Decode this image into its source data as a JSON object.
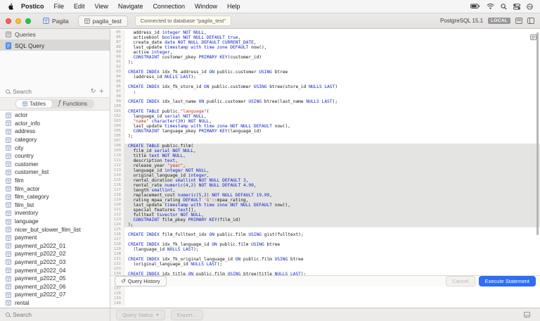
{
  "colors": {
    "accent": "#2e6ef2",
    "keyword": "#0d1fc4",
    "string": "#c52e1b",
    "number": "#0d1fc4"
  },
  "icons": {
    "refresh": "↻",
    "add": "+",
    "functions_glyph": "ƒ",
    "history": "↺"
  },
  "menu_bar": {
    "items": [
      "Postico",
      "File",
      "Edit",
      "View",
      "Navigate",
      "Connection",
      "Window",
      "Help"
    ],
    "status_icons": [
      "battery-icon",
      "wifi-icon",
      "search-icon",
      "control-center-icon",
      "siri-icon"
    ]
  },
  "title_bar": {
    "nav_label": "Pagila",
    "tab_label": "pagila_test",
    "status_message": "Connected to database \"pagila_test\"",
    "server_version": "PostgreSQL 15.1",
    "badge": "LOCAL"
  },
  "sidebar": {
    "queries_header": "Queries",
    "sql_query_label": "SQL Query",
    "search_placeholder": "Search",
    "tabs": [
      {
        "label": "Tables",
        "active": true
      },
      {
        "label": "Functions",
        "active": false
      }
    ],
    "tables": [
      "actor",
      "actor_info",
      "address",
      "category",
      "city",
      "country",
      "customer",
      "customer_list",
      "film",
      "film_actor",
      "film_category",
      "film_list",
      "inventory",
      "language",
      "nicer_but_slower_film_list",
      "payment",
      "payment_p2022_01",
      "payment_p2022_02",
      "payment_p2022_03",
      "payment_p2022_04",
      "payment_p2022_05",
      "payment_p2022_06",
      "payment_p2022_07",
      "rental"
    ],
    "bottom_search_placeholder": "Search"
  },
  "editor": {
    "selection": {
      "start": 108,
      "end": 124
    },
    "query_history_label": "Query History",
    "cancel_label": "Cancel",
    "execute_label": "Execute Statement",
    "lines": [
      {
        "n": 85,
        "s": [
          [
            "p",
            "  address_id "
          ],
          [
            "k",
            "integer"
          ],
          [
            "p",
            " "
          ],
          [
            "k",
            "NOT NULL"
          ],
          [
            "p",
            ","
          ]
        ]
      },
      {
        "n": 86,
        "s": [
          [
            "p",
            "  activebool "
          ],
          [
            "k",
            "boolean"
          ],
          [
            "p",
            " "
          ],
          [
            "k",
            "NOT NULL"
          ],
          [
            "p",
            " "
          ],
          [
            "k",
            "DEFAULT"
          ],
          [
            "p",
            " "
          ],
          [
            "k",
            "true"
          ],
          [
            "p",
            ","
          ]
        ]
      },
      {
        "n": 87,
        "s": [
          [
            "p",
            "  create_date "
          ],
          [
            "k",
            "date"
          ],
          [
            "p",
            " "
          ],
          [
            "k",
            "NOT NULL"
          ],
          [
            "p",
            " "
          ],
          [
            "k",
            "DEFAULT"
          ],
          [
            "p",
            " "
          ],
          [
            "k",
            "CURRENT_DATE"
          ],
          [
            "p",
            ","
          ]
        ]
      },
      {
        "n": 88,
        "s": [
          [
            "p",
            "  last_update "
          ],
          [
            "k",
            "timestamp with time zone"
          ],
          [
            "p",
            " "
          ],
          [
            "k",
            "DEFAULT"
          ],
          [
            "p",
            " now(),"
          ]
        ]
      },
      {
        "n": 89,
        "s": [
          [
            "p",
            "  active "
          ],
          [
            "k",
            "integer"
          ],
          [
            "p",
            ","
          ]
        ]
      },
      {
        "n": 90,
        "s": [
          [
            "p",
            "  "
          ],
          [
            "k",
            "CONSTRAINT"
          ],
          [
            "p",
            " customer_pkey "
          ],
          [
            "k",
            "PRIMARY KEY"
          ],
          [
            "p",
            "(customer_id)"
          ]
        ]
      },
      {
        "n": 91,
        "s": [
          [
            "p",
            ");"
          ]
        ]
      },
      {
        "n": 92,
        "s": []
      },
      {
        "n": 93,
        "s": [
          [
            "k",
            "CREATE INDEX"
          ],
          [
            "p",
            " idx_fk_address_id "
          ],
          [
            "k",
            "ON"
          ],
          [
            "p",
            " public.customer "
          ],
          [
            "k",
            "USING"
          ],
          [
            "p",
            " btree"
          ]
        ]
      },
      {
        "n": 94,
        "s": [
          [
            "p",
            "  (address_id "
          ],
          [
            "k",
            "NULLS LAST"
          ],
          [
            "p",
            ");"
          ]
        ]
      },
      {
        "n": 95,
        "s": []
      },
      {
        "n": 96,
        "s": [
          [
            "k",
            "CREATE INDEX"
          ],
          [
            "p",
            " idx_fk_store_id "
          ],
          [
            "k",
            "ON"
          ],
          [
            "p",
            " public.customer "
          ],
          [
            "k",
            "USING"
          ],
          [
            "p",
            " btree(store_id "
          ],
          [
            "k",
            "NULLS LAST"
          ],
          [
            "p",
            ")"
          ]
        ]
      },
      {
        "n": 97,
        "s": [
          [
            "p",
            "  ;"
          ]
        ]
      },
      {
        "n": 98,
        "s": []
      },
      {
        "n": 99,
        "s": [
          [
            "k",
            "CREATE INDEX"
          ],
          [
            "p",
            " idx_last_name "
          ],
          [
            "k",
            "ON"
          ],
          [
            "p",
            " public.customer "
          ],
          [
            "k",
            "USING"
          ],
          [
            "p",
            " btree(last_name "
          ],
          [
            "k",
            "NULLS LAST"
          ],
          [
            "p",
            ");"
          ]
        ]
      },
      {
        "n": 100,
        "s": []
      },
      {
        "n": 101,
        "s": [
          [
            "k",
            "CREATE TABLE"
          ],
          [
            "p",
            " public."
          ],
          [
            "s",
            "\"language\""
          ],
          [
            "p",
            "("
          ]
        ]
      },
      {
        "n": 102,
        "s": [
          [
            "p",
            "  language_id "
          ],
          [
            "k",
            "serial"
          ],
          [
            "p",
            " "
          ],
          [
            "k",
            "NOT NULL"
          ],
          [
            "p",
            ","
          ]
        ]
      },
      {
        "n": 103,
        "s": [
          [
            "p",
            "  "
          ],
          [
            "s",
            "\"name\""
          ],
          [
            "p",
            " "
          ],
          [
            "k",
            "character"
          ],
          [
            "p",
            "("
          ],
          [
            "n",
            "20"
          ],
          [
            "p",
            ") "
          ],
          [
            "k",
            "NOT NULL"
          ],
          [
            "p",
            ","
          ]
        ]
      },
      {
        "n": 104,
        "s": [
          [
            "p",
            "  last_update "
          ],
          [
            "k",
            "timestamp with time zone"
          ],
          [
            "p",
            " "
          ],
          [
            "k",
            "NOT NULL"
          ],
          [
            "p",
            " "
          ],
          [
            "k",
            "DEFAULT"
          ],
          [
            "p",
            " now(),"
          ]
        ]
      },
      {
        "n": 105,
        "s": [
          [
            "p",
            "  "
          ],
          [
            "k",
            "CONSTRAINT"
          ],
          [
            "p",
            " language_pkey "
          ],
          [
            "k",
            "PRIMARY KEY"
          ],
          [
            "p",
            "(language_id)"
          ]
        ]
      },
      {
        "n": 106,
        "s": [
          [
            "p",
            ");"
          ]
        ]
      },
      {
        "n": 107,
        "s": []
      },
      {
        "n": 108,
        "s": [
          [
            "k",
            "CREATE TABLE"
          ],
          [
            "p",
            " public.film("
          ]
        ]
      },
      {
        "n": 109,
        "s": [
          [
            "p",
            "  film_id "
          ],
          [
            "k",
            "serial"
          ],
          [
            "p",
            " "
          ],
          [
            "k",
            "NOT NULL"
          ],
          [
            "p",
            ","
          ]
        ]
      },
      {
        "n": 110,
        "s": [
          [
            "p",
            "  title "
          ],
          [
            "k",
            "text"
          ],
          [
            "p",
            " "
          ],
          [
            "k",
            "NOT NULL"
          ],
          [
            "p",
            ","
          ]
        ]
      },
      {
        "n": 111,
        "s": [
          [
            "p",
            "  description "
          ],
          [
            "k",
            "text"
          ],
          [
            "p",
            ","
          ]
        ]
      },
      {
        "n": 112,
        "s": [
          [
            "p",
            "  release_year "
          ],
          [
            "s",
            "\"year\""
          ],
          [
            "p",
            ","
          ]
        ]
      },
      {
        "n": 113,
        "s": [
          [
            "p",
            "  language_id "
          ],
          [
            "k",
            "integer"
          ],
          [
            "p",
            " "
          ],
          [
            "k",
            "NOT NULL"
          ],
          [
            "p",
            ","
          ]
        ]
      },
      {
        "n": 114,
        "s": [
          [
            "p",
            "  original_language_id "
          ],
          [
            "k",
            "integer"
          ],
          [
            "p",
            ","
          ]
        ]
      },
      {
        "n": 115,
        "s": [
          [
            "p",
            "  rental_duration "
          ],
          [
            "k",
            "smallint"
          ],
          [
            "p",
            " "
          ],
          [
            "k",
            "NOT NULL"
          ],
          [
            "p",
            " "
          ],
          [
            "k",
            "DEFAULT"
          ],
          [
            "p",
            " "
          ],
          [
            "n",
            "3"
          ],
          [
            "p",
            ","
          ]
        ]
      },
      {
        "n": 116,
        "s": [
          [
            "p",
            "  rental_rate "
          ],
          [
            "k",
            "numeric"
          ],
          [
            "p",
            "("
          ],
          [
            "n",
            "4,2"
          ],
          [
            "p",
            ") "
          ],
          [
            "k",
            "NOT NULL"
          ],
          [
            "p",
            " "
          ],
          [
            "k",
            "DEFAULT"
          ],
          [
            "p",
            " "
          ],
          [
            "n",
            "4.99"
          ],
          [
            "p",
            ","
          ]
        ]
      },
      {
        "n": 117,
        "s": [
          [
            "p",
            "  length "
          ],
          [
            "k",
            "smallint"
          ],
          [
            "p",
            ","
          ]
        ]
      },
      {
        "n": 118,
        "s": [
          [
            "p",
            "  replacement_cost "
          ],
          [
            "k",
            "numeric"
          ],
          [
            "p",
            "("
          ],
          [
            "n",
            "5,2"
          ],
          [
            "p",
            ") "
          ],
          [
            "k",
            "NOT NULL"
          ],
          [
            "p",
            " "
          ],
          [
            "k",
            "DEFAULT"
          ],
          [
            "p",
            " "
          ],
          [
            "n",
            "19.99"
          ],
          [
            "p",
            ","
          ]
        ]
      },
      {
        "n": 119,
        "s": [
          [
            "p",
            "  rating mpaa_rating "
          ],
          [
            "k",
            "DEFAULT"
          ],
          [
            "p",
            " "
          ],
          [
            "s",
            "'G'"
          ],
          [
            "p",
            "::mpaa_rating,"
          ]
        ]
      },
      {
        "n": 120,
        "s": [
          [
            "p",
            "  last_update "
          ],
          [
            "k",
            "timestamp with time zone"
          ],
          [
            "p",
            " "
          ],
          [
            "k",
            "NOT NULL"
          ],
          [
            "p",
            " "
          ],
          [
            "k",
            "DEFAULT"
          ],
          [
            "p",
            " now(),"
          ]
        ]
      },
      {
        "n": 121,
        "s": [
          [
            "p",
            "  special_features "
          ],
          [
            "k",
            "text"
          ],
          [
            "p",
            "[],"
          ]
        ]
      },
      {
        "n": 122,
        "s": [
          [
            "p",
            "  fulltext "
          ],
          [
            "k",
            "tsvector"
          ],
          [
            "p",
            " "
          ],
          [
            "k",
            "NOT NULL"
          ],
          [
            "p",
            ","
          ]
        ]
      },
      {
        "n": 123,
        "s": [
          [
            "p",
            "  "
          ],
          [
            "k",
            "CONSTRAINT"
          ],
          [
            "p",
            " film_pkey "
          ],
          [
            "k",
            "PRIMARY KEY"
          ],
          [
            "p",
            "(film_id)"
          ]
        ]
      },
      {
        "n": 124,
        "s": [
          [
            "p",
            ");"
          ]
        ]
      },
      {
        "n": 125,
        "s": []
      },
      {
        "n": 126,
        "s": [
          [
            "k",
            "CREATE INDEX"
          ],
          [
            "p",
            " film_fulltext_idx "
          ],
          [
            "k",
            "ON"
          ],
          [
            "p",
            " public.film "
          ],
          [
            "k",
            "USING"
          ],
          [
            "p",
            " gist(fulltext);"
          ]
        ]
      },
      {
        "n": 127,
        "s": []
      },
      {
        "n": 128,
        "s": [
          [
            "k",
            "CREATE INDEX"
          ],
          [
            "p",
            " idx_fk_language_id "
          ],
          [
            "k",
            "ON"
          ],
          [
            "p",
            " public.film "
          ],
          [
            "k",
            "USING"
          ],
          [
            "p",
            " btree"
          ]
        ]
      },
      {
        "n": 129,
        "s": [
          [
            "p",
            "  (language_id "
          ],
          [
            "k",
            "NULLS LAST"
          ],
          [
            "p",
            ");"
          ]
        ]
      },
      {
        "n": 130,
        "s": []
      },
      {
        "n": 131,
        "s": [
          [
            "k",
            "CREATE INDEX"
          ],
          [
            "p",
            " idx_fk_original_language_id "
          ],
          [
            "k",
            "ON"
          ],
          [
            "p",
            " public.film "
          ],
          [
            "k",
            "USING"
          ],
          [
            "p",
            " btree"
          ]
        ]
      },
      {
        "n": 132,
        "s": [
          [
            "p",
            "  (original_language_id "
          ],
          [
            "k",
            "NULLS LAST"
          ],
          [
            "p",
            ");"
          ]
        ]
      },
      {
        "n": 133,
        "s": []
      },
      {
        "n": 134,
        "s": [
          [
            "k",
            "CREATE INDEX"
          ],
          [
            "p",
            " idx_title "
          ],
          [
            "k",
            "ON"
          ],
          [
            "p",
            " public.film "
          ],
          [
            "k",
            "USING"
          ],
          [
            "p",
            " btree(title "
          ],
          [
            "k",
            "NULLS LAST"
          ],
          [
            "p",
            ");"
          ]
        ]
      },
      {
        "n": 135,
        "s": []
      },
      {
        "n": 136,
        "s": []
      },
      {
        "n": 137,
        "s": []
      },
      {
        "n": 138,
        "s": []
      },
      {
        "n": 139,
        "s": []
      },
      {
        "n": 140,
        "s": []
      }
    ]
  },
  "bottom_bar": {
    "query_status_label": "Query Status",
    "export_label": "Export..."
  }
}
